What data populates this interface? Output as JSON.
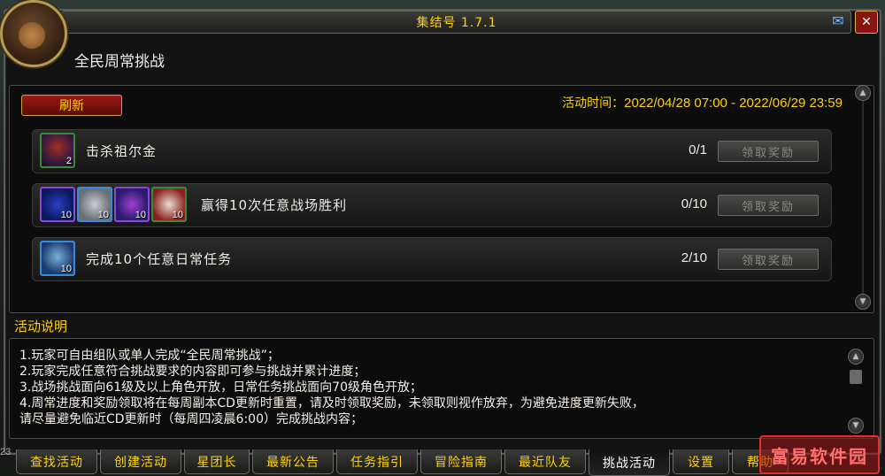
{
  "window": {
    "title": "集结号 1.7.1",
    "close_label": "✕",
    "mail_icon": "✉"
  },
  "header": {
    "title": "全民周常挑战"
  },
  "toolbar": {
    "refresh_label": "刷新",
    "time_label": "活动时间：",
    "time_value": "2022/04/28 07:00 - 2022/06/29 23:59"
  },
  "challenges": [
    {
      "label": "击杀祖尔金",
      "progress": "0/1",
      "claim_label": "领取奖励",
      "rewards": [
        {
          "icon": "zuljin-portrait-icon",
          "count": "2"
        }
      ]
    },
    {
      "label": "赢得10次任意战场胜利",
      "progress": "0/10",
      "claim_label": "领取奖励",
      "rewards": [
        {
          "icon": "blue-necklace-icon",
          "count": "10"
        },
        {
          "icon": "silver-orb-icon",
          "count": "10"
        },
        {
          "icon": "purple-gem-icon",
          "count": "10"
        },
        {
          "icon": "mahjong-tile-icon",
          "count": "10"
        }
      ]
    },
    {
      "label": "完成10个任意日常任务",
      "progress": "2/10",
      "claim_label": "领取奖励",
      "rewards": [
        {
          "icon": "frost-helm-icon",
          "count": "10"
        }
      ]
    }
  ],
  "description": {
    "section_label": "活动说明",
    "lines": [
      "1.玩家可自由组队或单人完成“全民周常挑战”；",
      "2.玩家完成任意符合挑战要求的内容即可参与挑战并累计进度；",
      "3.战场挑战面向61级及以上角色开放，日常任务挑战面向70级角色开放；",
      "4.周常进度和奖励领取将在每周副本CD更新时重置，请及时领取奖励，未领取则视作放弃，为避免进度更新失败，",
      "请尽量避免临近CD更新时（每周四凌晨6:00）完成挑战内容；"
    ]
  },
  "tabs": [
    {
      "label": "查找活动"
    },
    {
      "label": "创建活动"
    },
    {
      "label": "星团长"
    },
    {
      "label": "最新公告"
    },
    {
      "label": "任务指引"
    },
    {
      "label": "冒险指南"
    },
    {
      "label": "最近队友"
    },
    {
      "label": "挑战活动"
    },
    {
      "label": "设置"
    },
    {
      "label": "帮助"
    }
  ],
  "active_tab": "挑战活动",
  "left_edge_number": "23",
  "watermark": "富易软件园",
  "colors": {
    "accent_gold": "#ffd200",
    "refresh_red": "#9a1a12",
    "panel_bg": "#0c0c0c"
  }
}
